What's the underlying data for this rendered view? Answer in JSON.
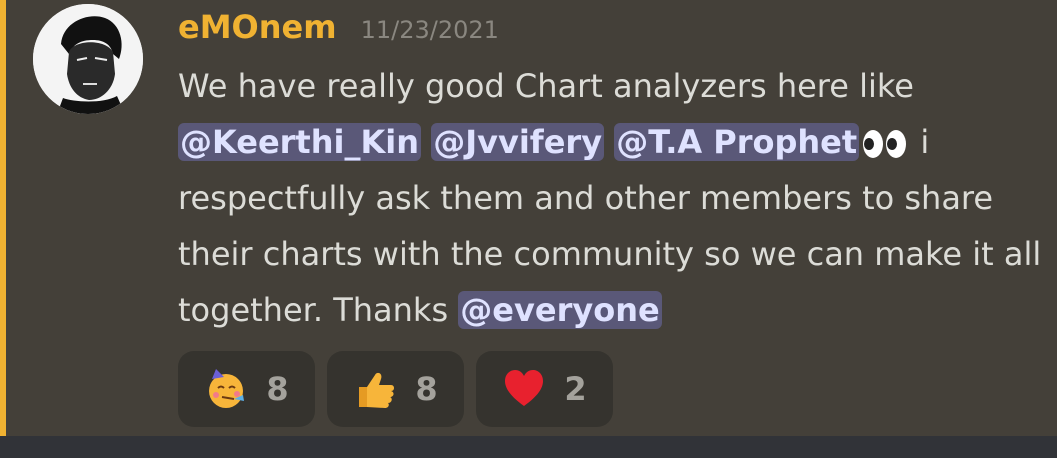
{
  "message": {
    "username": "eMOnem",
    "timestamp": "11/23/2021",
    "text_1": "We have really good Chart analyzers here like",
    "mentions": [
      "@Keerthi_Kin",
      "@Jvvifery",
      "@T.A Prophet"
    ],
    "text_2": " i respectfully ask them and other members to share their charts with the community so we can make it all together. Thanks ",
    "mention_everyone": "@everyone",
    "inline_emoji": "eyes-icon"
  },
  "reactions": [
    {
      "icon": "party-face-icon",
      "count": "8"
    },
    {
      "icon": "thumbs-up-icon",
      "count": "8"
    },
    {
      "icon": "red-heart-icon",
      "count": "2"
    }
  ],
  "colors": {
    "accent": "#f0b232",
    "background": "#444039",
    "mention_bg": "#5a5878",
    "reaction_bg": "#35332e"
  }
}
